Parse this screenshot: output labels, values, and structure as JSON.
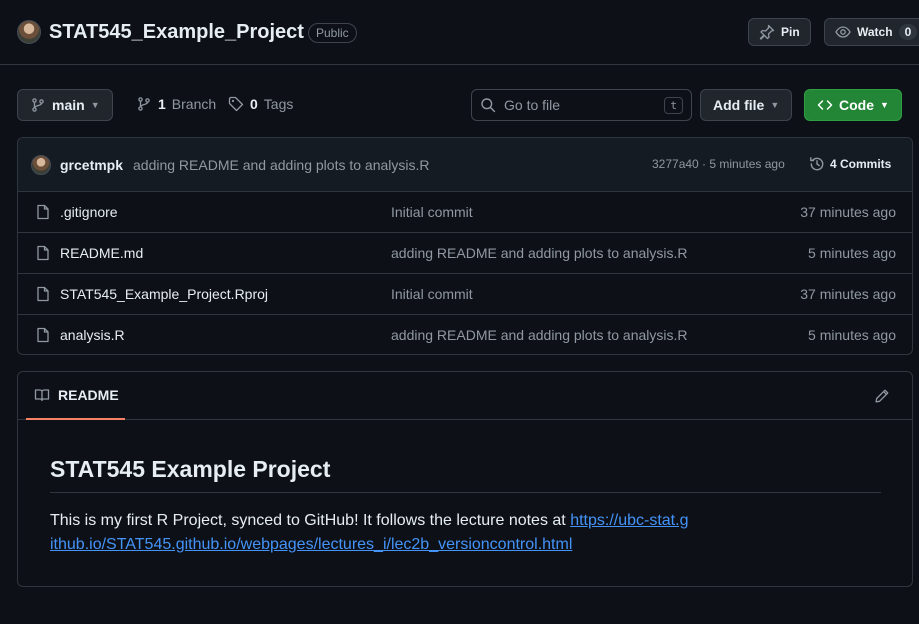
{
  "repo": {
    "name": "STAT545_Example_Project",
    "visibility": "Public",
    "pin_label": "Pin",
    "watch_label": "Watch",
    "watch_count": "0"
  },
  "toolbar": {
    "branch": "main",
    "branch_count": "1",
    "branch_label": "Branch",
    "tag_count": "0",
    "tag_label": "Tags",
    "search_placeholder": "Go to file",
    "search_shortcut": "t",
    "add_file_label": "Add file",
    "code_label": "Code"
  },
  "latest_commit": {
    "author": "grcetmpk",
    "message": "adding README and adding plots to analysis.R",
    "hash_time": "3277a40 · 5 minutes ago",
    "commits_label": "4 Commits"
  },
  "files": [
    {
      "name": ".gitignore",
      "commit": "Initial commit",
      "age": "37 minutes ago"
    },
    {
      "name": "README.md",
      "commit": "adding README and adding plots to analysis.R",
      "age": "5 minutes ago"
    },
    {
      "name": "STAT545_Example_Project.Rproj",
      "commit": "Initial commit",
      "age": "37 minutes ago"
    },
    {
      "name": "analysis.R",
      "commit": "adding README and adding plots to analysis.R",
      "age": "5 minutes ago"
    }
  ],
  "readme": {
    "tab_label": "README",
    "heading": "STAT545 Example Project",
    "text": "This is my first R Project, synced to GitHub! It follows the lecture notes at ",
    "link": "https://ubc-stat.github.io/STAT545.github.io/webpages/lectures_i/lec2b_versioncontrol.html"
  },
  "colors": {
    "background": "#0d1117",
    "border": "#30363d",
    "accent_green": "#238636",
    "link": "#4493f8",
    "tab_underline": "#f78166"
  }
}
